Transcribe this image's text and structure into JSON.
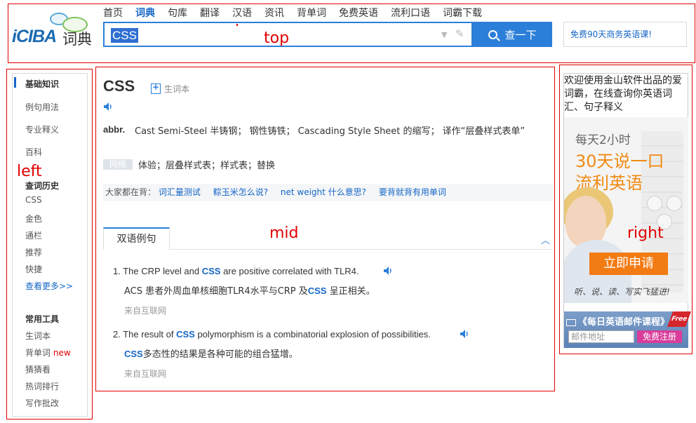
{
  "overlay": {
    "top": "top",
    "left": "left",
    "mid": "mid",
    "right": "right"
  },
  "header": {
    "logo_brand": "iCIBA",
    "logo_cn": "词典",
    "nav": [
      "首页",
      "词典",
      "句库",
      "翻译",
      "汉语",
      "资讯",
      "背单词",
      "免费英语",
      "流利口语",
      "词霸下载"
    ],
    "search_value": "CSS",
    "search_button": "查一下",
    "promo_text": "免费90天商务英语课!"
  },
  "sidebar": {
    "section1_items": [
      "基础知识",
      "例句用法",
      "专业释义",
      "百科"
    ],
    "history_title": "查词历史",
    "history_items": [
      "CSS",
      "金色",
      "通栏",
      "推荐",
      "快捷"
    ],
    "more_link": "查看更多>>",
    "tools_title": "常用工具",
    "tools_items": [
      "生词本",
      "背单词",
      "猜猜看",
      "热词排行",
      "写作批改"
    ],
    "new_tag": "new"
  },
  "main": {
    "word": "CSS",
    "vocab_label": "生词本",
    "pos": "abbr.",
    "definition": "Cast Semi-Steel 半铸钢； 钢性铸铁； Cascading Style Sheet 的缩写； 译作“层叠样式表单”",
    "net_tag": "网络",
    "net_definition": "体验；层叠样式表；样式表；替换",
    "hot_label": "大家都在背：",
    "hot_links": [
      "词汇量测试",
      "粽玉米怎么说?",
      "net weight 什么意思?",
      "要背就背有用单词"
    ],
    "tab_label": "双语例句",
    "examples": [
      {
        "num": "1.",
        "en_before": "The CRP level and ",
        "en_key": "CSS",
        "en_after": " are positive correlated with TLR4.",
        "cn_before": "ACS 患者外周血单核细胞TLR4水平与CRP 及",
        "cn_key": "CSS",
        "cn_after": " 呈正相关。",
        "source": "来自互联网"
      },
      {
        "num": "2.",
        "en_before": "The result of ",
        "en_key": "CSS",
        "en_after": " polymorphism is a combinatorial explosion of possibilities.",
        "cn_before": "",
        "cn_key": "CSS",
        "cn_after": "多态性的结果是各种可能的组合猛增。",
        "source": "来自互联网"
      }
    ]
  },
  "right_panel": {
    "welcome": "欢迎使用金山软件出品的爱词霸，在线查询你英语词汇、句子释义",
    "ad_line1": "每天2小时",
    "ad_line2a": "30天说一口",
    "ad_line2b": "流利英语",
    "ad_cta": "立即申请",
    "ad_slogan": "听、说、读、写实飞猛进!",
    "mail_title": "《每日英语邮件课程》",
    "free_tag": "Free",
    "mail_placeholder": "邮件地址",
    "mail_button": "免费注册"
  }
}
